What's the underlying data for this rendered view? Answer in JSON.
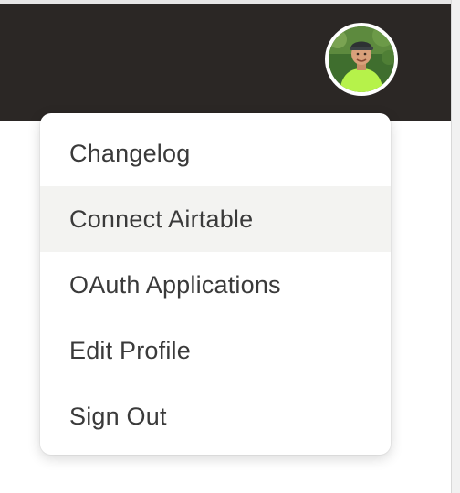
{
  "header": {
    "background_color": "#2b2725",
    "avatar_alt": "User avatar"
  },
  "menu": {
    "items": [
      {
        "label": "Changelog",
        "highlighted": false
      },
      {
        "label": "Connect Airtable",
        "highlighted": true
      },
      {
        "label": "OAuth Applications",
        "highlighted": false
      },
      {
        "label": "Edit Profile",
        "highlighted": false
      },
      {
        "label": "Sign Out",
        "highlighted": false
      }
    ],
    "highlight_color": "#f3f3f1"
  }
}
